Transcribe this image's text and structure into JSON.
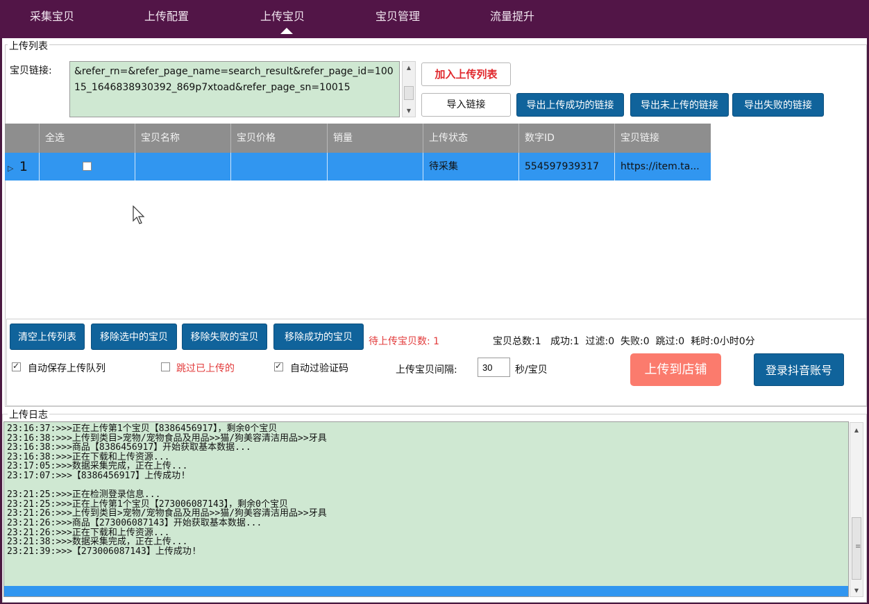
{
  "nav": {
    "tabs": [
      "采集宝贝",
      "上传配置",
      "上传宝贝",
      "宝贝管理",
      "流量提升"
    ],
    "active_index": 2
  },
  "upload_list": {
    "legend": "上传列表",
    "link_label": "宝贝链接:",
    "link_value": "&refer_rn=&refer_page_name=search_result&refer_page_id=10015_1646838930392_869p7xtoad&refer_page_sn=10015",
    "add_button": "加入上传列表",
    "import_button": "导入链接",
    "export_success_button": "导出上传成功的链接",
    "export_unuploaded_button": "导出未上传的链接",
    "export_failed_button": "导出失败的链接"
  },
  "grid": {
    "columns": [
      "全选",
      "宝贝名称",
      "宝贝价格",
      "销量",
      "上传状态",
      "数字ID",
      "宝贝链接"
    ],
    "rows": [
      {
        "index": "1",
        "name": "",
        "price": "",
        "sales": "",
        "status": "待采集",
        "id": "554597939317",
        "link": "https://item.ta..."
      }
    ]
  },
  "controls": {
    "clear_button": "清空上传列表",
    "remove_selected_button": "移除选中的宝贝",
    "remove_failed_button": "移除失败的宝贝",
    "remove_success_button": "移除成功的宝贝",
    "pending_label": "待上传宝贝数: 1",
    "stats": "宝贝总数:1   成功:1  过滤:0  失败:0  跳过:0  耗时:0小时0分",
    "auto_save_label": "自动保存上传队列",
    "skip_uploaded_label": "跳过已上传的",
    "auto_captcha_label": "自动过验证码",
    "interval_label": "上传宝贝间隔:",
    "interval_value": "30",
    "interval_unit": "秒/宝贝",
    "upload_button": "上传到店铺",
    "login_button": "登录抖音账号",
    "auto_save_checked": true,
    "skip_uploaded_checked": false,
    "auto_captcha_checked": true
  },
  "log": {
    "legend": "上传日志",
    "lines": [
      "23:16:37:>>>正在上传第1个宝贝【8386456917】，剩余0个宝贝",
      "23:16:38:>>>上传到类目>宠物/宠物食品及用品>>猫/狗美容清洁用品>>牙具",
      "23:16:38:>>>商品【8386456917】开始获取基本数据...",
      "23:16:38:>>>正在下载和上传资源...",
      "23:17:05:>>>数据采集完成，正在上传...",
      "23:17:07:>>>【8386456917】上传成功!",
      "",
      "23:21:25:>>>正在检测登录信息...",
      "23:21:25:>>>正在上传第1个宝贝【273006087143】，剩余0个宝贝",
      "23:21:26:>>>上传到类目>宠物/宠物食品及用品>>猫/狗美容清洁用品>>牙具",
      "23:21:26:>>>商品【273006087143】开始获取基本数据...",
      "23:21:26:>>>正在下载和上传资源...",
      "23:21:38:>>>数据采集完成，正在上传...",
      "23:21:39:>>>【273006087143】上传成功!"
    ]
  },
  "colors": {
    "nav_bg": "#521547",
    "accent_blue": "#10639b",
    "upload_button": "#fb7b6d",
    "selection": "#3196f0",
    "log_bg": "#cfe8d2"
  }
}
